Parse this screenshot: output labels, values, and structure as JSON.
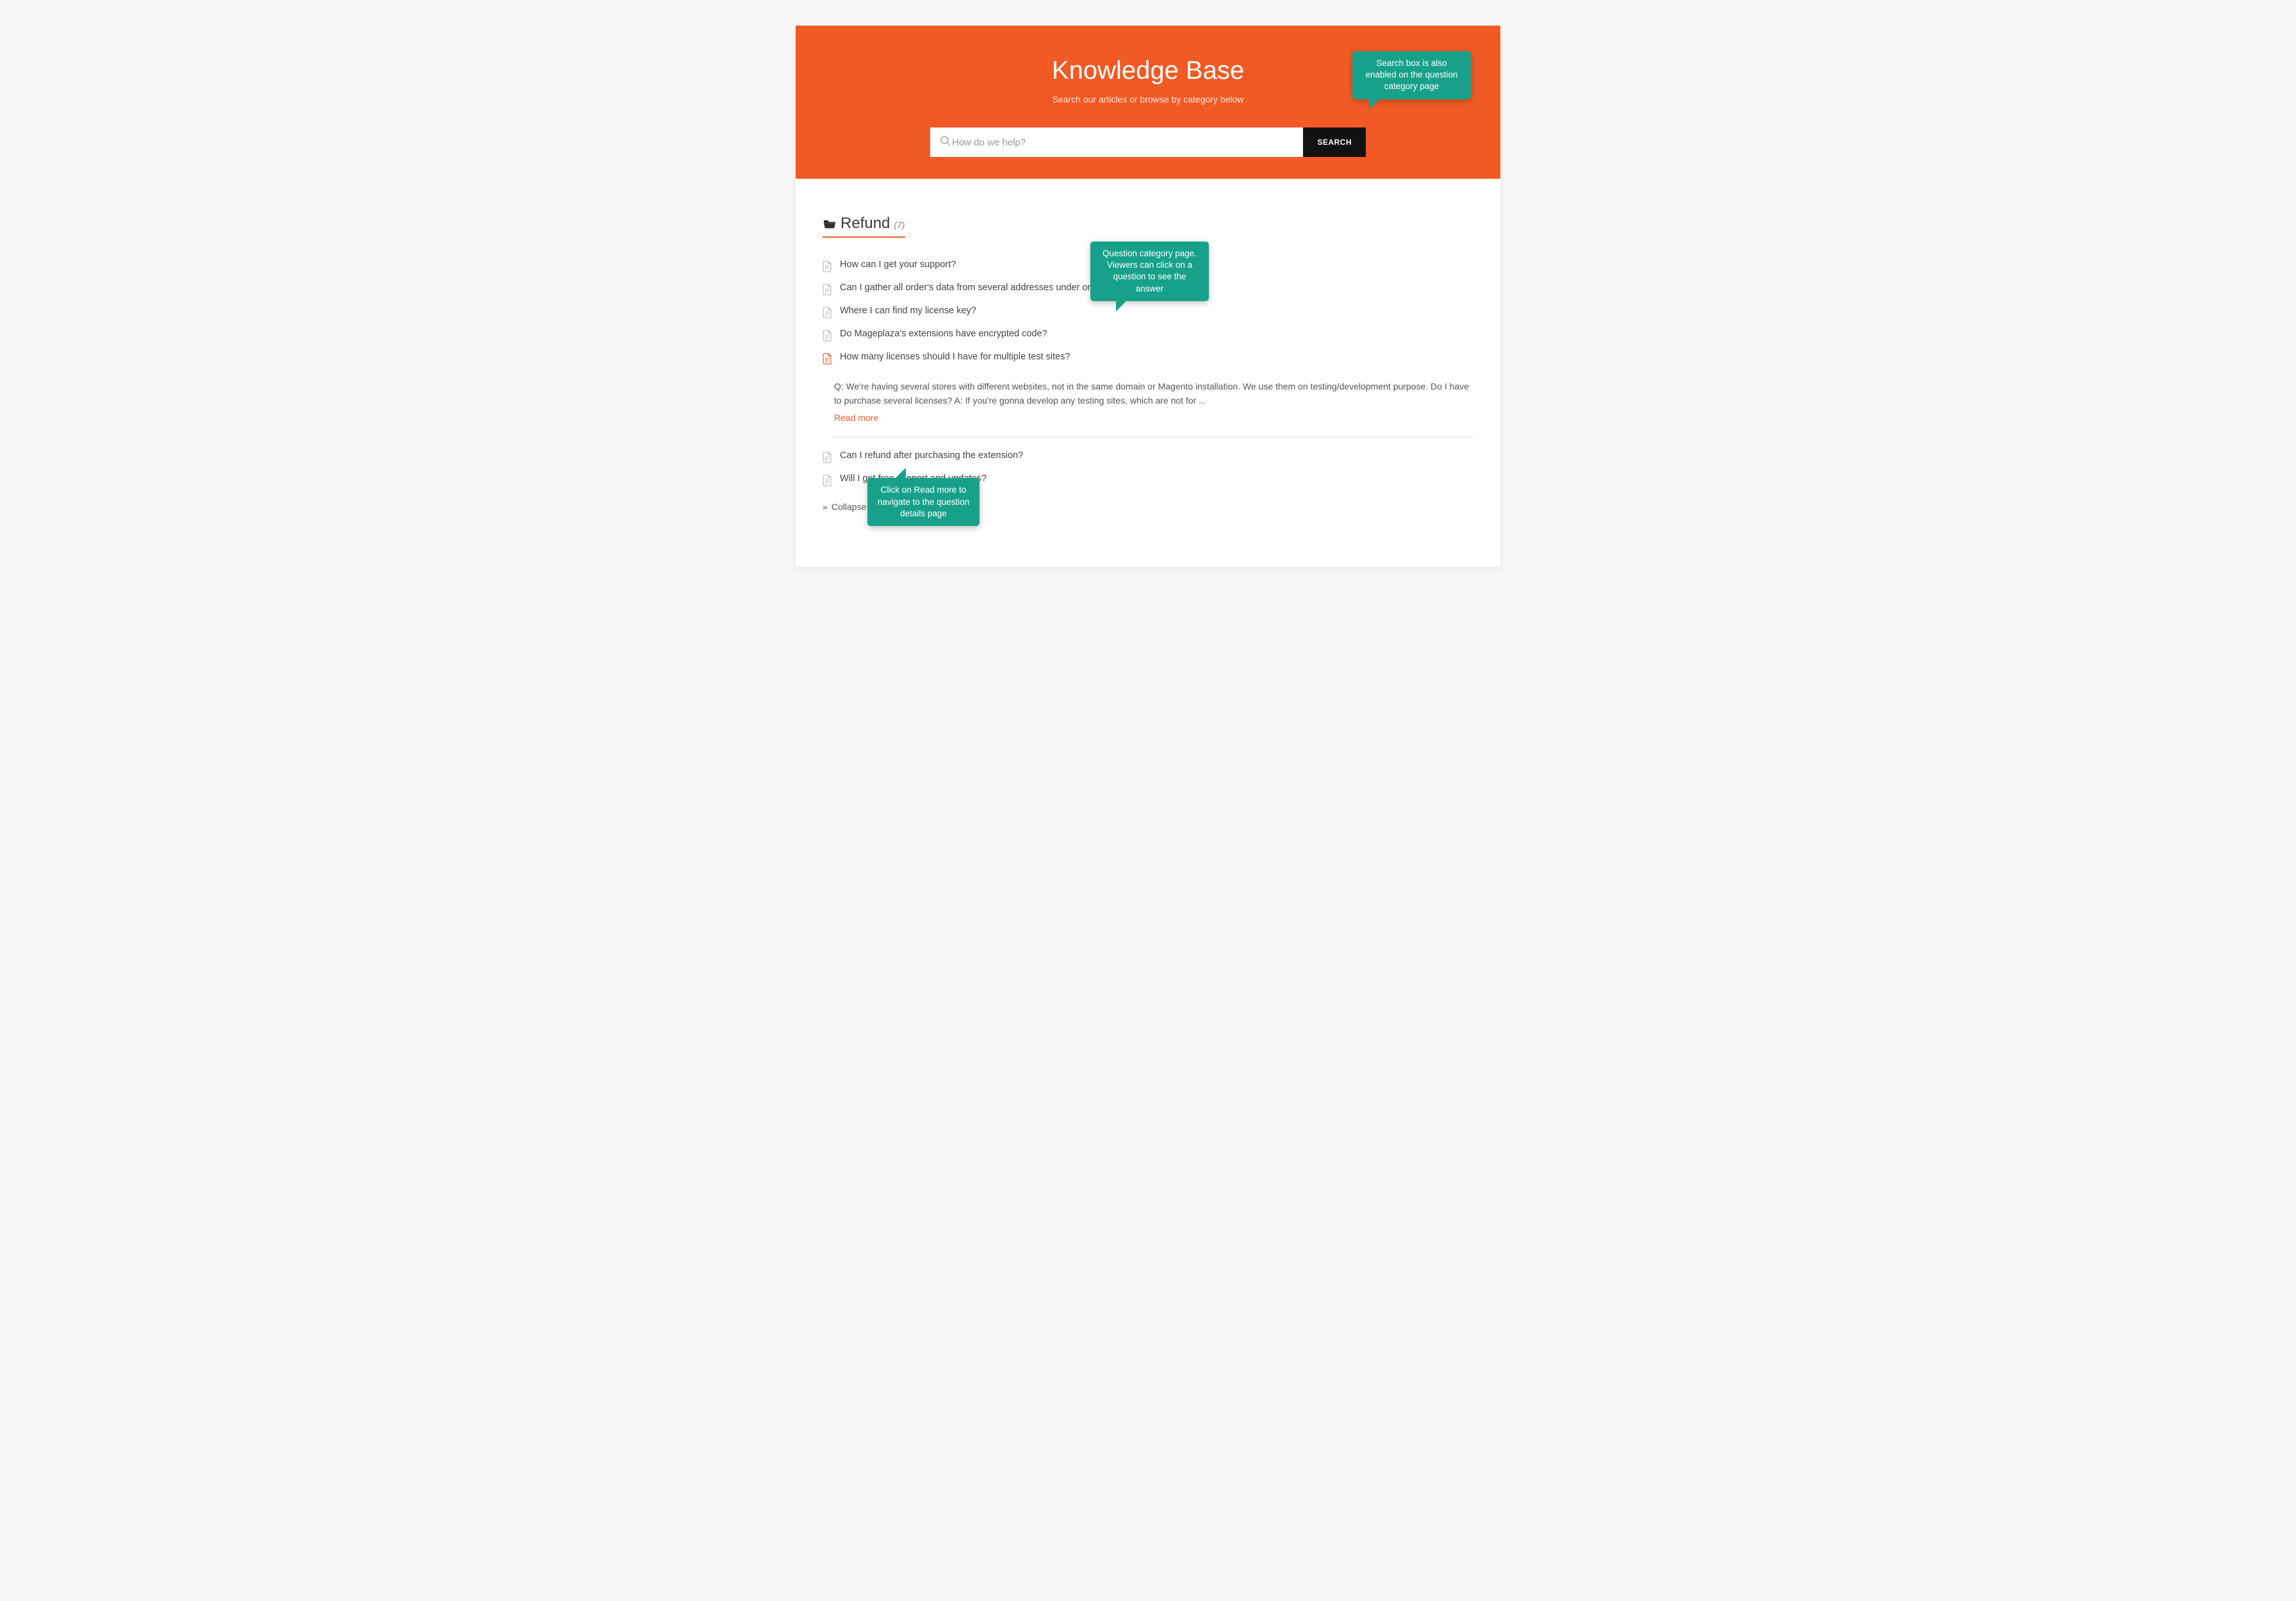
{
  "hero": {
    "title": "Knowledge Base",
    "subtitle": "Search our articles or browse by category below",
    "search_placeholder": "How do we help?",
    "search_button": "SEARCH"
  },
  "category": {
    "name": "Refund",
    "count": "(7)"
  },
  "questions": [
    {
      "title": "How can I get your support?",
      "active": false
    },
    {
      "title": "Can I gather all order's data from several addresses under one email?",
      "active": false
    },
    {
      "title": "Where I can find my license key?",
      "active": false
    },
    {
      "title": "Do Mageplaza's extensions have encrypted code?",
      "active": false
    },
    {
      "title": "How many licenses should I have for multiple test sites?",
      "active": true,
      "excerpt": "Q: We're having several stores with different websites, not in the same domain or Magento installation. We use them on testing/development purpose. Do I have to purchase several licenses? A: If you're gonna develop any testing sites, which are not for ...",
      "read_more": "Read more"
    },
    {
      "title": "Can I refund after purchasing the extension?",
      "active": false
    },
    {
      "title": "Will I get free support and updates?",
      "active": false
    }
  ],
  "collapse_label": "Collapse",
  "callouts": {
    "c1": "Search box is also enabled on the question category page",
    "c2": "Question category page. Viewers can click on a question to see the answer",
    "c3": "Click on Read more to navigate to the question details page"
  },
  "colors": {
    "accent": "#f15a25",
    "callout": "#18a18a"
  }
}
